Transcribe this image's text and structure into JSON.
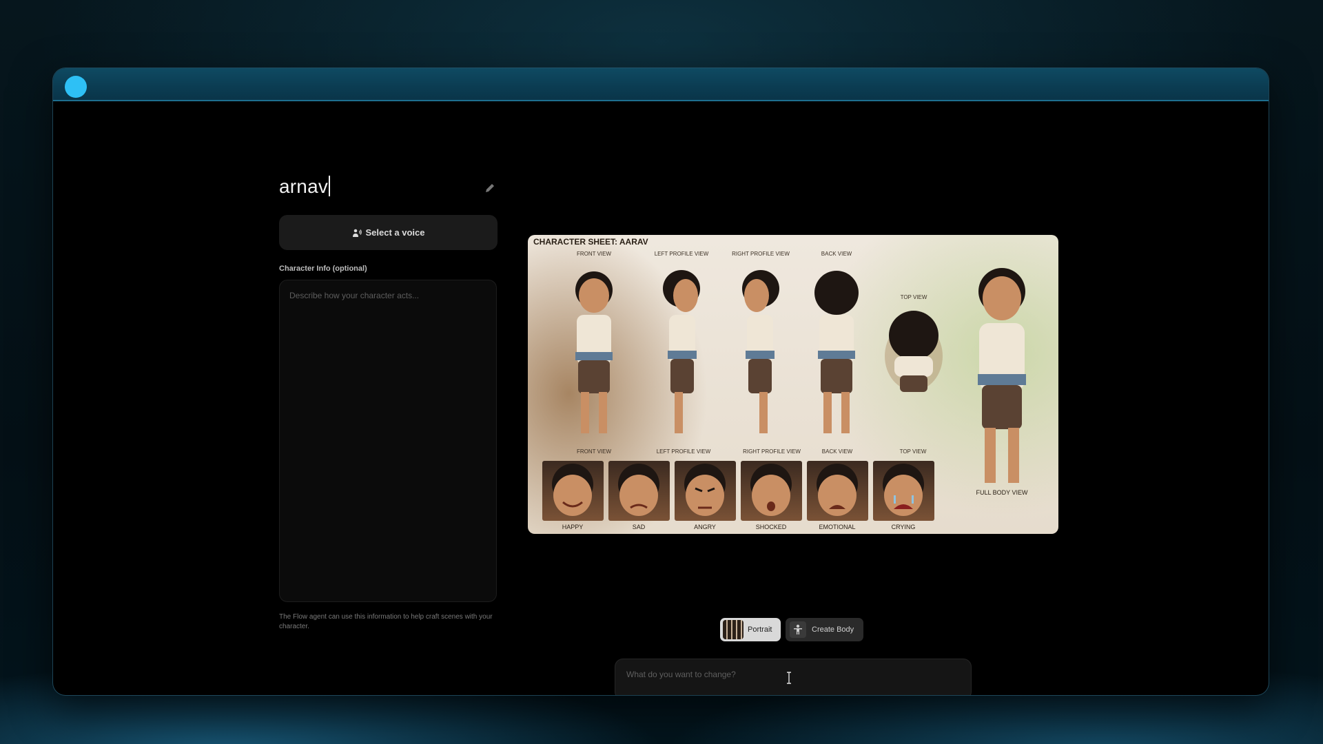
{
  "character": {
    "name": "arnav",
    "voice_button_label": "Select a voice",
    "info_label": "Character Info (optional)",
    "info_placeholder": "Describe how your character acts...",
    "info_note": "The Flow agent can use this information to help craft scenes with your character."
  },
  "sheet": {
    "title": "CHARACTER SHEET: AARAV",
    "top_views": [
      "FRONT VIEW",
      "LEFT PROFILE VIEW",
      "RIGHT PROFILE VIEW",
      "BACK VIEW",
      "TOP VIEW"
    ],
    "bottom_views": [
      "FRONT VIEW",
      "LEFT PROFILE VIEW",
      "RIGHT PROFILE VIEW",
      "BACK VIEW",
      "TOP VIEW"
    ],
    "expressions": [
      "HAPPY",
      "SAD",
      "ANGRY",
      "SHOCKED",
      "EMOTIONAL",
      "CRYING"
    ],
    "full_body_label": "FULL BODY VIEW"
  },
  "controls": {
    "portrait_label": "Portrait",
    "create_body_label": "Create Body",
    "prompt_placeholder": "What do you want to change?"
  },
  "colors": {
    "accent_dot": "#2ec0f5",
    "window_bg": "#000000",
    "titlebar": "#0b3c52"
  }
}
